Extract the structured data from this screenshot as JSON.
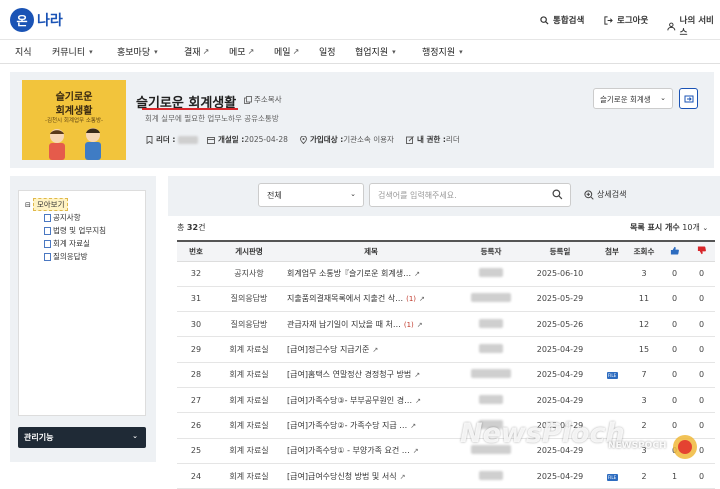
{
  "header": {
    "logo_badge": "온",
    "logo_text": "나라",
    "util": [
      {
        "label": "통합검색",
        "icon": "search-icon"
      },
      {
        "label": "로그아웃",
        "icon": "logout-icon"
      },
      {
        "label": "나의 서비스",
        "icon": "user-icon"
      }
    ]
  },
  "nav": {
    "items": [
      {
        "label": "지식",
        "chevron": false,
        "ext": false
      },
      {
        "label": "커뮤니티",
        "chevron": true,
        "ext": false
      },
      {
        "label": "홍보마당",
        "chevron": true,
        "ext": false
      },
      {
        "label": "결재",
        "chevron": false,
        "ext": true
      },
      {
        "label": "메모",
        "chevron": false,
        "ext": true
      },
      {
        "label": "메일",
        "chevron": false,
        "ext": true
      },
      {
        "label": "일정",
        "chevron": false,
        "ext": false
      },
      {
        "label": "협업지원",
        "chevron": true,
        "ext": false
      },
      {
        "label": "행정지원",
        "chevron": true,
        "ext": false
      }
    ]
  },
  "club": {
    "thumb_line1": "슬기로운",
    "thumb_line2": "회계생활",
    "thumb_line3": "-김천시 회계업무 소통방-",
    "title": "슬기로운 회계생활",
    "copy_addr": "주소복사",
    "desc": "회계 실무에 필요한 업무노하우 공유소통방",
    "leader_label": "리더 :",
    "opened_label": "개설일 :",
    "opened_value": "2025-04-28",
    "join_label": "가입대상 :",
    "join_value": "기관소속 이용자",
    "my_role_label": "내 권한 :",
    "my_role_value": "리더",
    "select_value": "슬기로운 회계생",
    "accent": "#1a53b5",
    "underline_color": "#d8262a"
  },
  "sidebar": {
    "root": "모아보기",
    "items": [
      "공지사항",
      "법령 및 업무지침",
      "회계 자료실",
      "질의응답방"
    ],
    "mgmt_label": "관리기능"
  },
  "search": {
    "select_value": "전체",
    "placeholder": "검색어를 입력해주세요.",
    "advanced": "상세검색"
  },
  "list": {
    "total_prefix": "총",
    "total_count": "32",
    "total_suffix": "건",
    "perpage_label": "목록 표시 개수",
    "perpage_value": "10개",
    "columns": [
      "번호",
      "게시판명",
      "제목",
      "등록자",
      "등록일",
      "첨부",
      "조회수"
    ],
    "rows": [
      {
        "no": "32",
        "board": "공지사항",
        "title": "회계업무 소통방『슬기로운 회계생…",
        "comments": "",
        "date": "2025-06-10",
        "file": false,
        "views": "3",
        "up": "0",
        "down": "0"
      },
      {
        "no": "31",
        "board": "질의응답방",
        "title": "지출품의결재목록에서 지출건 삭…",
        "comments": "(1)",
        "date": "2025-05-29",
        "file": false,
        "views": "11",
        "up": "0",
        "down": "0"
      },
      {
        "no": "30",
        "board": "질의응답방",
        "title": "관급자재 납기일이 지났을 때 처…",
        "comments": "(1)",
        "date": "2025-05-26",
        "file": false,
        "views": "12",
        "up": "0",
        "down": "0"
      },
      {
        "no": "29",
        "board": "회계 자료실",
        "title": "[급여]정근수당 지급기준",
        "comments": "",
        "date": "2025-04-29",
        "file": false,
        "views": "15",
        "up": "0",
        "down": "0"
      },
      {
        "no": "28",
        "board": "회계 자료실",
        "title": "[급여]홈택스 연말정산 경정청구 방법",
        "comments": "",
        "date": "2025-04-29",
        "file": true,
        "views": "7",
        "up": "0",
        "down": "0"
      },
      {
        "no": "27",
        "board": "회계 자료실",
        "title": "[급여]가족수당③- 부부공무원인 경…",
        "comments": "",
        "date": "2025-04-29",
        "file": false,
        "views": "3",
        "up": "0",
        "down": "0"
      },
      {
        "no": "26",
        "board": "회계 자료실",
        "title": "[급여]가족수당②- 가족수당 지급 …",
        "comments": "",
        "date": "2025-04-29",
        "file": false,
        "views": "2",
        "up": "0",
        "down": "0"
      },
      {
        "no": "25",
        "board": "회계 자료실",
        "title": "[급여]가족수당① - 부양가족 요건 …",
        "comments": "",
        "date": "2025-04-29",
        "file": false,
        "views": "3",
        "up": "0",
        "down": "0"
      },
      {
        "no": "24",
        "board": "회계 자료실",
        "title": "[급여]급여수당신청 방법 및 서식",
        "comments": "",
        "date": "2025-04-29",
        "file": true,
        "views": "2",
        "up": "1",
        "down": "0"
      }
    ]
  },
  "watermark": {
    "main": "NewsPloch",
    "small": "NEWSPOCH"
  }
}
